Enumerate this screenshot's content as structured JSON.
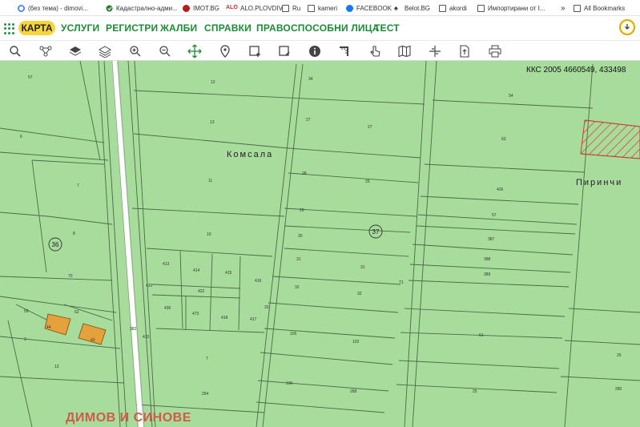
{
  "bookmarks": [
    {
      "label": "(без тема) - dimovi...",
      "icon": "google-icon",
      "color": "#4285f4"
    },
    {
      "label": "Кадастрално-адми...",
      "icon": "cadastre-icon",
      "color": "#2e7d32"
    },
    {
      "label": "IMOT.BG",
      "icon": "imot-icon",
      "color": "#b71c1c"
    },
    {
      "label": "ALO.PLOVDIV",
      "icon": "alo-icon",
      "color": "#d32f2f"
    },
    {
      "label": "Ru",
      "icon": "folder-icon"
    },
    {
      "label": "kameri",
      "icon": "folder-icon"
    },
    {
      "label": "FACEBOOK",
      "icon": "facebook-icon",
      "color": "#1877f2"
    },
    {
      "label": "Belot.BG",
      "icon": "spade-icon"
    },
    {
      "label": "akordi",
      "icon": "folder-icon"
    },
    {
      "label": "Импортирани от I...",
      "icon": "folder-icon"
    },
    {
      "label": "»",
      "icon": "more-icon"
    },
    {
      "label": "All Bookmarks",
      "icon": "folder-icon"
    }
  ],
  "nav": {
    "active": "КАРТА",
    "items": [
      "УСЛУГИ",
      "РЕГИСТРИ",
      "ЖАЛБИ",
      "СПРАВКИ",
      "ПРАВОСПОСОБНИ ЛИЦА",
      "ТЕСТ"
    ]
  },
  "toolbar": [
    "search-icon",
    "network-icon",
    "layers-filled-icon",
    "layers-icon",
    "zoom-in-icon",
    "zoom-out-icon",
    "pan-icon",
    "pin-icon",
    "select-rect-icon",
    "select-edit-icon",
    "info-icon",
    "measure-icon",
    "pointer-icon",
    "map-icon",
    "cross-icon",
    "export-icon",
    "print-icon"
  ],
  "colors": {
    "accent": "#1a8c35",
    "highlight": "#f6d53b",
    "parcel": "#a8dc9c",
    "building": "#e5a13b",
    "hatch": "#d33"
  },
  "map": {
    "coordinates": "ККС 2005 4660549, 433498",
    "places": [
      "Комсала",
      "Пиринчи"
    ],
    "firm": "ДИМОВ И СИНОВЕ",
    "markers": [
      "36",
      "37"
    ],
    "parcels": [
      "57",
      "12",
      "34",
      "54",
      "6",
      "13",
      "27",
      "27",
      "63",
      "7",
      "11",
      "28",
      "29",
      "426",
      "29",
      "57",
      "8",
      "10",
      "30",
      "387",
      "413",
      "414",
      "415",
      "416",
      "31",
      "31",
      "389",
      "388",
      "70",
      "420",
      "32",
      "32",
      "59",
      "436",
      "473",
      "418",
      "417",
      "62",
      "44",
      "43",
      "33",
      "103",
      "105",
      "61",
      "2",
      "7",
      "254",
      "382",
      "13",
      "106",
      "268",
      "415",
      "422",
      "71",
      "25",
      "280",
      "25"
    ]
  }
}
